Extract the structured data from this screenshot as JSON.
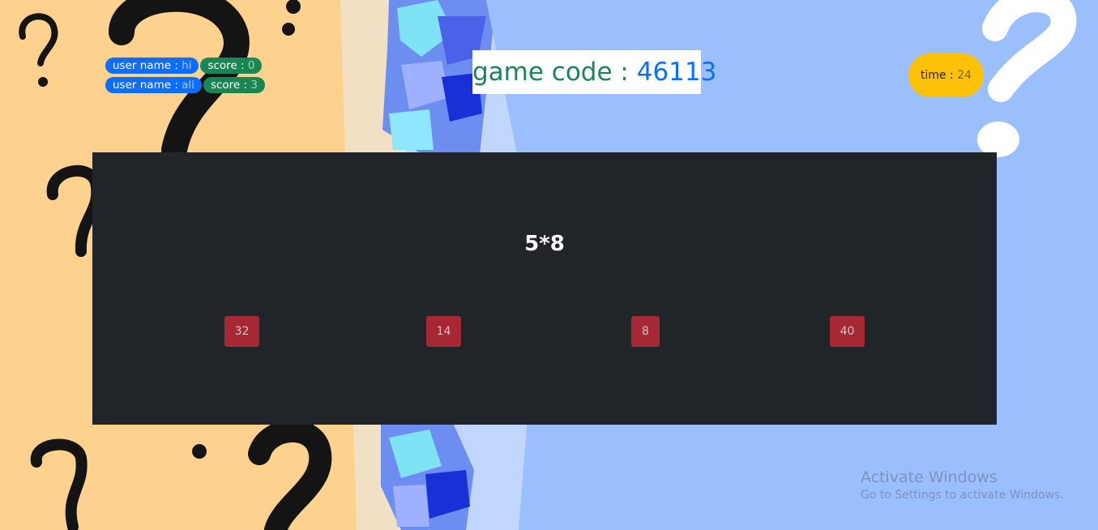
{
  "players": [
    {
      "user_label": "user name : ",
      "user_name": "hi",
      "score_label": "score : ",
      "score": "0"
    },
    {
      "user_label": "user name : ",
      "user_name": "ali",
      "score_label": "score : ",
      "score": "3"
    }
  ],
  "game_code": {
    "label": "game code : ",
    "value": "46113"
  },
  "timer": {
    "label": "time : ",
    "value": "24"
  },
  "question": {
    "text": "5*8"
  },
  "answers": [
    "32",
    "14",
    "8",
    "40"
  ],
  "watermark": {
    "title": "Activate Windows",
    "subtitle": "Go to Settings to activate Windows."
  },
  "colors": {
    "user_pill": "#0d6efd",
    "score_pill": "#198754",
    "timer": "#ffc107",
    "board": "#212529",
    "answer_button": "#a52834",
    "background_left": "#fdd28e",
    "background_right": "#9bbefd"
  }
}
